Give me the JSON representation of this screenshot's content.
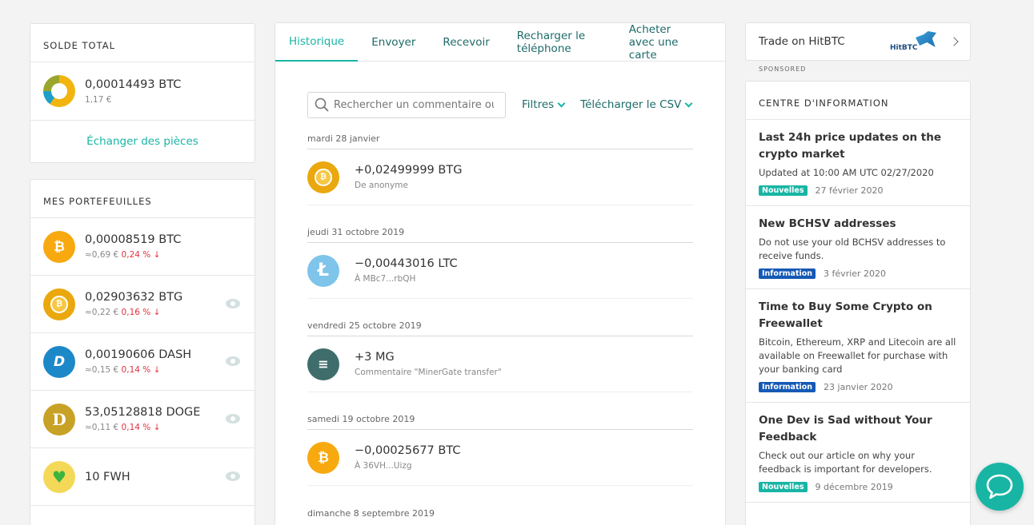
{
  "balance": {
    "title": "SOLDE TOTAL",
    "btc": "0,00014493 BTC",
    "fiat": "1,17 €",
    "exchange_link": "Échanger des pièces"
  },
  "wallets": {
    "title": "MES PORTEFEUILLES",
    "items": [
      {
        "amount": "0,00008519 BTC",
        "fiat": "≈0,69 €",
        "change": "0,24 % ↓",
        "icon": "bitcoin-icon"
      },
      {
        "amount": "0,02903632 BTG",
        "fiat": "≈0,22 €",
        "change": "0,16 % ↓",
        "icon": "bitcoin-gold-icon"
      },
      {
        "amount": "0,00190606 DASH",
        "fiat": "≈0,15 €",
        "change": "0,14 % ↓",
        "icon": "dash-icon"
      },
      {
        "amount": "53,05128818 DOGE",
        "fiat": "≈0,11 €",
        "change": "0,14 % ↓",
        "icon": "dogecoin-icon"
      },
      {
        "amount": "10 FWH",
        "icon": "green-heart-icon"
      }
    ]
  },
  "history": {
    "tabs": [
      "Historique",
      "Envoyer",
      "Recevoir",
      "Recharger le téléphone",
      "Acheter avec une carte"
    ],
    "search_placeholder": "Rechercher un commentaire ou",
    "filters_label": "Filtres",
    "csv_label": "Télécharger le CSV",
    "groups": [
      {
        "date": "mardi 28 janvier",
        "amount": "+0,02499999 BTG",
        "desc": "De anonyme",
        "icon": "bitcoin-gold-icon"
      },
      {
        "date": "jeudi 31 octobre 2019",
        "amount": "−0,00443016 LTC",
        "desc": "À MBc7...rbQH",
        "icon": "litecoin-icon"
      },
      {
        "date": "vendredi 25 octobre 2019",
        "amount": "+3 MG",
        "desc": "Commentaire \"MinerGate transfer\"",
        "icon": "minergate-icon"
      },
      {
        "date": "samedi 19 octobre 2019",
        "amount": "−0,00025677 BTC",
        "desc": "À 36VH...Uizg",
        "icon": "bitcoin-icon"
      },
      {
        "date": "dimanche 8 septembre 2019"
      }
    ]
  },
  "hitbtc": {
    "label": "Trade on HitBTC",
    "logo_text": "HitBTC",
    "sponsored": "SPONSORED"
  },
  "info": {
    "title": "CENTRE D'INFORMATION",
    "items": [
      {
        "title": "Last 24h price updates on the crypto market",
        "body": "Updated at 10:00 AM UTC 02/27/2020",
        "badge": "Nouvelles",
        "date": "27 février 2020"
      },
      {
        "title": "New BCHSV addresses",
        "body": "Do not use your old BCHSV addresses to receive funds.",
        "badge": "Information",
        "date": "3 février 2020"
      },
      {
        "title": "Time to Buy Some Crypto on Freewallet",
        "body": "Bitcoin, Ethereum, XRP and Litecoin are all available on Freewallet for purchase with your banking card",
        "badge": "Information",
        "date": "23 janvier 2020"
      },
      {
        "title": "One Dev is Sad without Your Feedback",
        "body": "Check out our article on why your feedback is important for developers.",
        "badge": "Nouvelles",
        "date": "9 décembre 2019"
      }
    ]
  },
  "colors": {
    "accent": "#18b5a4",
    "negative": "#e0313e",
    "info_badge": "#1559b5"
  }
}
